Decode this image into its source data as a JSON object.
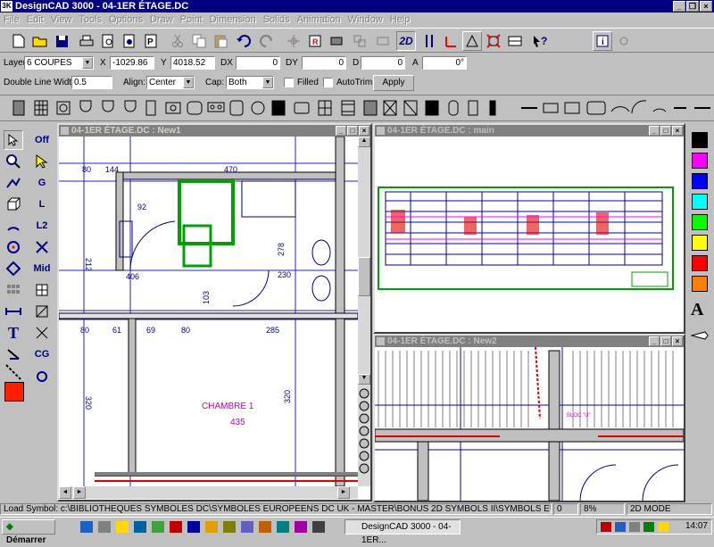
{
  "app": {
    "title": "DesignCAD 3000 - 04-1ER ÉTAGE.DC",
    "icon_label": "3K"
  },
  "menu": [
    "File",
    "Edit",
    "View",
    "Tools",
    "Options",
    "Draw",
    "Point",
    "Dimension",
    "Solids",
    "Animation",
    "Window",
    "Help"
  ],
  "toolbar1": {
    "mode_2d": "2D"
  },
  "coords": {
    "layer_label": "Layer",
    "layer_value": "6  COUPES",
    "x_label": "X",
    "x_value": "-1029.86",
    "y_label": "Y",
    "y_value": "4018.52",
    "dx_label": "DX",
    "dx_value": "0",
    "dy_label": "DY",
    "dy_value": "0",
    "d_label": "D",
    "d_value": "0",
    "a_label": "A",
    "a_value": "0°"
  },
  "doubleline": {
    "width_label": "Double Line Width:",
    "width_value": "0.5",
    "align_label": "Align:",
    "align_value": "Center",
    "cap_label": "Cap:",
    "cap_value": "Both",
    "filled_label": "Filled",
    "autotrim_label": "AutoTrim",
    "apply_label": "Apply"
  },
  "left_palette": {
    "off_label": "Off",
    "g_label": "G",
    "l_label": "L",
    "l2_label": "L2",
    "mid_label": "Mid",
    "cg_label": "CG",
    "text_tool": "T"
  },
  "right_palette": {
    "colors": [
      "#000000",
      "#ff00ff",
      "#0000ff",
      "#00ffff",
      "#00ff00",
      "#ffff00",
      "#ff0000",
      "#ff8000"
    ],
    "text_tool": "A"
  },
  "windows": {
    "new1": {
      "title": "04-1ER ÉTAGE.DC : New1"
    },
    "main": {
      "title": "04-1ER ÉTAGE.DC : main"
    },
    "new2": {
      "title": "04-1ER ÉTAGE.DC : New2"
    }
  },
  "plan": {
    "room_name": "CHAMBRE 1",
    "room_value": "435",
    "dims": [
      "80",
      "144",
      "470",
      "92",
      "212",
      "406",
      "278",
      "230",
      "103",
      "80",
      "61",
      "69",
      "80",
      "285",
      "320",
      "320"
    ],
    "label_bloc": "BLOC \"U\""
  },
  "status": {
    "message": "Load Symbol: c:\\BIBLIOTHEQUES SYMBOLES DC\\SYMBOLES EUROPÉENS DC UK - MASTER\\BONUS 2D SYMBOLS II\\SYMBOLS EUROP\\Bain_Bad_B",
    "count": "0",
    "percent": "8%",
    "mode": "2D MODE"
  },
  "taskbar": {
    "start_label": "Démarrer",
    "task_label": "DesignCAD 3000 - 04-1ER...",
    "clock": "14:07"
  }
}
